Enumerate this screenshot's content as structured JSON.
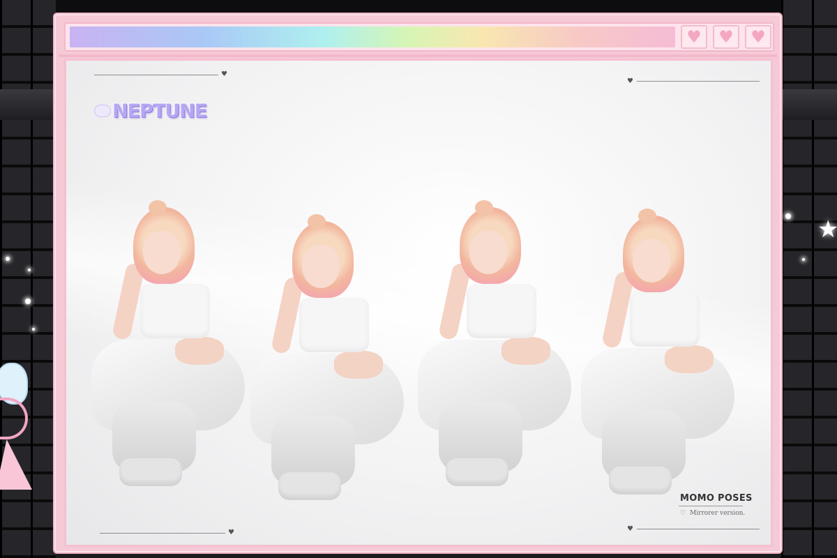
{
  "window": {
    "buttons": [
      {
        "icon": "heart-icon",
        "glyph": "♥"
      },
      {
        "icon": "heart-icon",
        "glyph": "♥"
      },
      {
        "icon": "heart-icon",
        "glyph": "♥"
      }
    ]
  },
  "brand": {
    "logo_text": "NEPTUNE"
  },
  "decor": {
    "heart_glyph": "♥"
  },
  "caption": {
    "title": "MOMO POSES",
    "heart": "♡",
    "subtitle": "Mirrorer version."
  },
  "colors": {
    "frame_pink": "#f6c9d7",
    "heart_pink": "#f3a7c0",
    "logo_lavender": "#b7a6f3"
  }
}
